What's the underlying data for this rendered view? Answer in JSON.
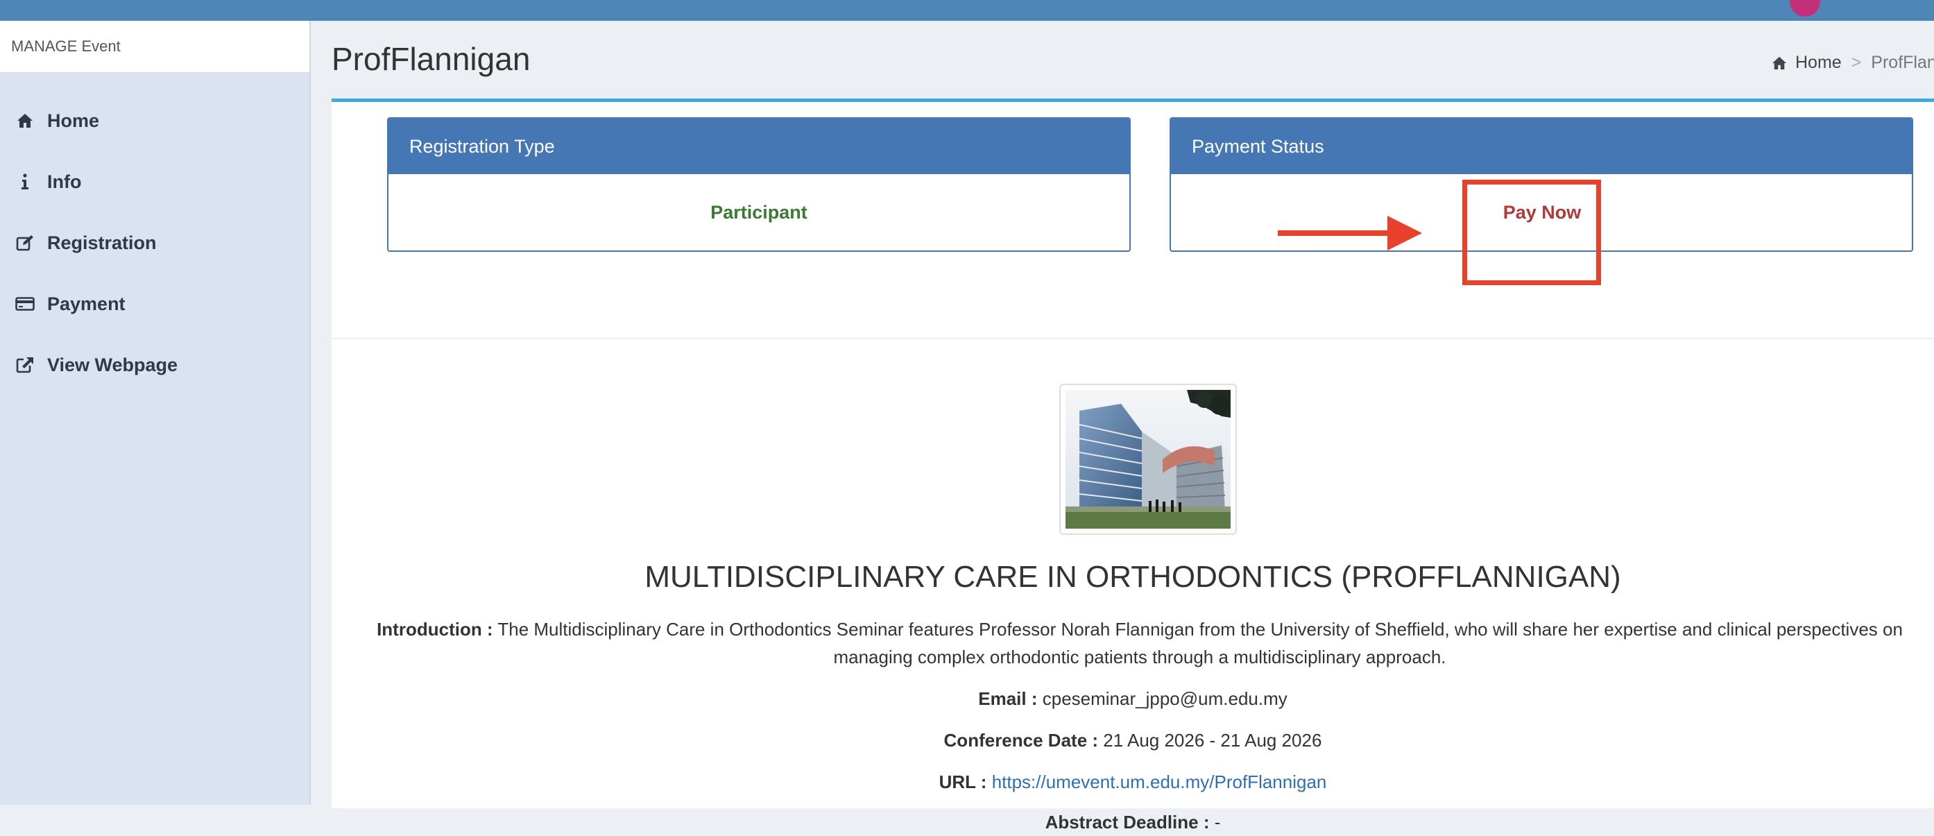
{
  "sidebar": {
    "section_header": "MANAGE Event",
    "items": [
      {
        "label": "Home",
        "icon": "home-icon"
      },
      {
        "label": "Info",
        "icon": "info-icon"
      },
      {
        "label": "Registration",
        "icon": "edit-icon"
      },
      {
        "label": "Payment",
        "icon": "credit-card-icon"
      },
      {
        "label": "View Webpage",
        "icon": "external-link-icon"
      }
    ]
  },
  "header": {
    "title": "ProfFlannigan",
    "breadcrumb": {
      "home": "Home",
      "separator": ">",
      "current": "ProfFlann"
    }
  },
  "registration_type": {
    "heading": "Registration Type",
    "value": "Participant"
  },
  "payment_status": {
    "heading": "Payment Status",
    "value": "Pay Now"
  },
  "event": {
    "title": "MULTIDISCIPLINARY CARE IN ORTHODONTICS (PROFFLANNIGAN)",
    "intro_label": "Introduction :",
    "intro_text": "The Multidisciplinary Care in Orthodontics Seminar features Professor Norah Flannigan from the University of Sheffield, who will share her expertise and clinical perspectives on managing complex orthodontic patients through a multidisciplinary approach.",
    "email_label": "Email :",
    "email": "cpeseminar_jppo@um.edu.my",
    "date_label": "Conference Date :",
    "date": "21 Aug 2026 - 21 Aug 2026",
    "url_label": "URL :",
    "url": "https://umevent.um.edu.my/ProfFlannigan",
    "abstract_label": "Abstract Deadline :",
    "abstract_value": "-"
  },
  "colors": {
    "topbar": "#4d86b7",
    "sidebar": "#dbe2f1",
    "box_header": "#4477b3",
    "participant": "#3b7a32",
    "pay_now": "#b03a3a",
    "annotation": "#e8412c",
    "link": "#2f6fb0"
  }
}
